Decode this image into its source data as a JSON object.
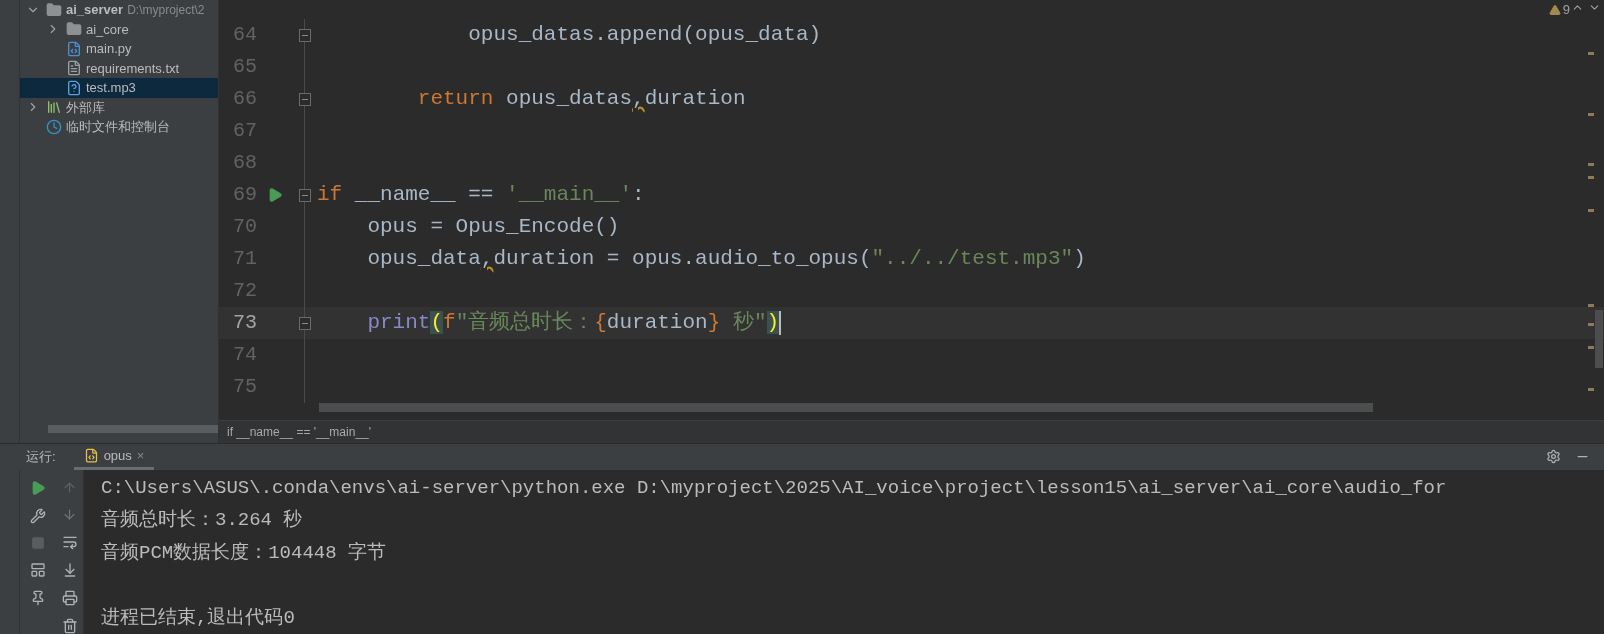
{
  "project_tree": [
    {
      "name": "ai_server",
      "path": "D:\\myproject\\2",
      "kind": "folder",
      "expanded": true,
      "selected": false,
      "children": [
        {
          "name": "ai_core",
          "kind": "folder",
          "expanded": false,
          "selected": false
        },
        {
          "name": "main.py",
          "kind": "python",
          "selected": false
        },
        {
          "name": "requirements.txt",
          "kind": "text",
          "selected": false
        },
        {
          "name": "test.mp3",
          "kind": "unknown",
          "selected": true
        }
      ]
    },
    {
      "name": "外部库",
      "kind": "library",
      "expanded": false,
      "selected": false
    },
    {
      "name": "临时文件和控制台",
      "kind": "scratch",
      "selected": false
    }
  ],
  "editor": {
    "warnings": "9",
    "lines": [
      {
        "number": "64",
        "fold": true,
        "run": false,
        "current": false,
        "tokens": [
          {
            "text": "            opus_datas.append(opus_data)",
            "kind": "plain"
          }
        ]
      },
      {
        "number": "65",
        "fold": false,
        "run": false,
        "current": false
      },
      {
        "number": "66",
        "fold": true,
        "run": false,
        "current": false,
        "tokens": [
          {
            "text": "        return",
            "kind": "keyword"
          },
          {
            "text": " opus_datas",
            "kind": "plain"
          },
          {
            "text": ",",
            "kind": "warning"
          },
          {
            "text": "duration",
            "kind": "plain"
          }
        ]
      },
      {
        "number": "67",
        "fold": false,
        "run": false,
        "current": false
      },
      {
        "number": "68",
        "fold": false,
        "run": false,
        "current": false
      },
      {
        "number": "69",
        "fold": true,
        "run": true,
        "current": false,
        "tokens": [
          {
            "text": "if",
            "kind": "keyword"
          },
          {
            "text": " __name__ == ",
            "kind": "plain"
          },
          {
            "text": "'__main__'",
            "kind": "string"
          },
          {
            "text": ":",
            "kind": "plain"
          }
        ]
      },
      {
        "number": "70",
        "fold": false,
        "run": false,
        "current": false,
        "tokens": [
          {
            "text": "    opus = Opus_Encode()",
            "kind": "plain"
          }
        ]
      },
      {
        "number": "71",
        "fold": false,
        "run": false,
        "current": false,
        "tokens": [
          {
            "text": "    opus_data",
            "kind": "plain"
          },
          {
            "text": ",",
            "kind": "warning"
          },
          {
            "text": "duration = opus.audio_to_opus(",
            "kind": "plain"
          },
          {
            "text": "\"../../test.mp3\"",
            "kind": "string"
          },
          {
            "text": ")",
            "kind": "plain"
          }
        ]
      },
      {
        "number": "72",
        "fold": false,
        "run": false,
        "current": false
      },
      {
        "number": "73",
        "fold": true,
        "run": false,
        "current": true,
        "tokens": [
          {
            "text": "    print",
            "kind": "builtin"
          },
          {
            "text": "(",
            "kind": "paren-match"
          },
          {
            "text": "f",
            "kind": "keyword"
          },
          {
            "text": "\"音频总时长：",
            "kind": "string"
          },
          {
            "text": "{",
            "kind": "keyword"
          },
          {
            "text": "duration",
            "kind": "plain"
          },
          {
            "text": "}",
            "kind": "keyword"
          },
          {
            "text": " 秒\"",
            "kind": "string"
          },
          {
            "text": ")",
            "kind": "paren-match"
          }
        ]
      },
      {
        "number": "74",
        "fold": false,
        "run": false,
        "current": false
      },
      {
        "number": "75",
        "fold": false,
        "run": false,
        "current": false
      }
    ]
  },
  "breadcrumb": "if __name__ == '__main__'",
  "run_panel": {
    "label": "运行:",
    "tabs": [
      {
        "label": "opus",
        "close": "×",
        "selected": true
      }
    ],
    "console": [
      {
        "text": "C:\\Users\\ASUS\\.conda\\envs\\ai-server\\python.exe D:\\myproject\\2025\\AI_voice\\project\\lesson15\\ai_server\\ai_core\\audio_for",
        "blank_before": false
      },
      {
        "text": "音频总时长：3.264 秒",
        "blank_before": false
      },
      {
        "text": "音频PCM数据长度：104448 字节",
        "blank_before": false
      },
      {
        "text": "进程已结束,退出代码0",
        "blank_before": true
      }
    ]
  }
}
